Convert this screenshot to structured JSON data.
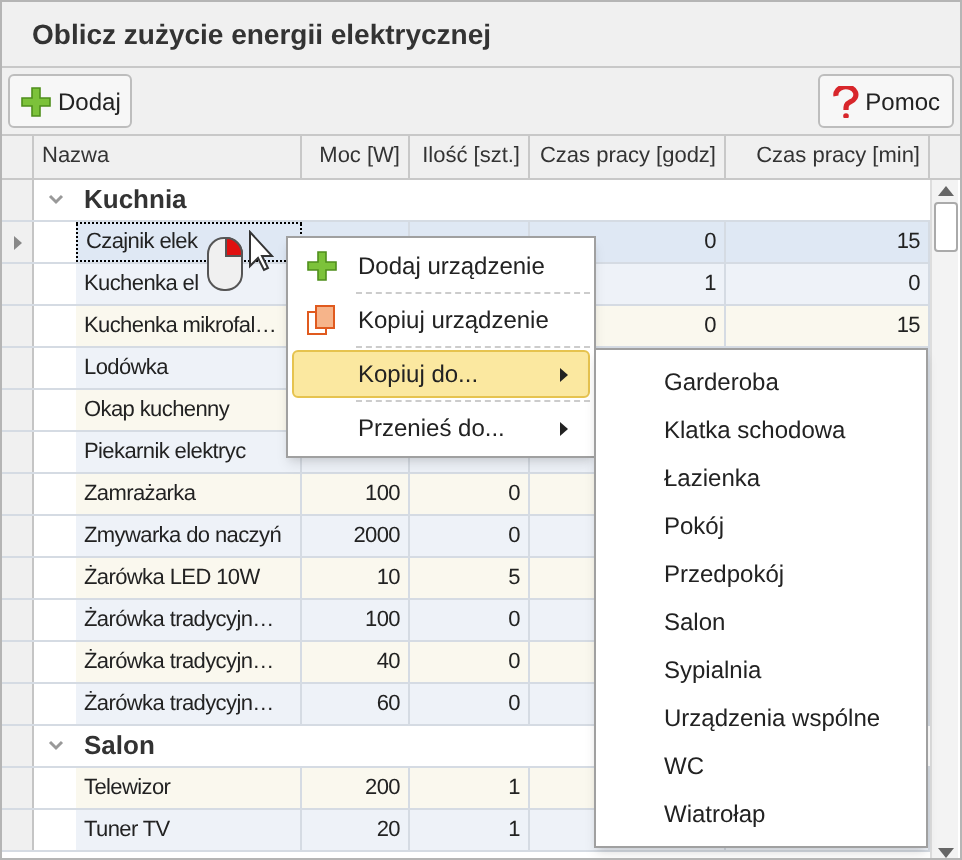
{
  "window": {
    "title": "Oblicz zużycie energii elektrycznej"
  },
  "toolbar": {
    "add_button": "Dodaj",
    "help_button": "Pomoc"
  },
  "table": {
    "columns": [
      "Nazwa",
      "Moc [W]",
      "Ilość [szt.]",
      "Czas pracy [godz]",
      "Czas pracy [min]"
    ],
    "groups": [
      {
        "name": "Kuchnia",
        "expanded": true,
        "rows": [
          {
            "cells": [
              "Czajnik elek",
              "",
              "",
              "0",
              "15"
            ],
            "selected": true
          },
          {
            "cells": [
              "Kuchenka el",
              "",
              "",
              "1",
              "0"
            ],
            "selected": false
          },
          {
            "cells": [
              "Kuchenka mikrofal…",
              "",
              "",
              "0",
              "15"
            ],
            "selected": false
          },
          {
            "cells": [
              "Lodówka",
              "",
              "",
              "",
              ""
            ],
            "selected": false
          },
          {
            "cells": [
              "Okap kuchenny",
              "",
              "",
              "",
              ""
            ],
            "selected": false
          },
          {
            "cells": [
              "Piekarnik elektryc",
              "",
              "",
              "",
              ""
            ],
            "selected": false
          },
          {
            "cells": [
              "Zamrażarka",
              "100",
              "0",
              "",
              ""
            ],
            "selected": false
          },
          {
            "cells": [
              "Zmywarka do naczyń",
              "2000",
              "0",
              "",
              ""
            ],
            "selected": false
          },
          {
            "cells": [
              "Żarówka LED 10W",
              "10",
              "5",
              "",
              ""
            ],
            "selected": false
          },
          {
            "cells": [
              "Żarówka tradycyjn…",
              "100",
              "0",
              "",
              ""
            ],
            "selected": false
          },
          {
            "cells": [
              "Żarówka tradycyjn…",
              "40",
              "0",
              "",
              ""
            ],
            "selected": false
          },
          {
            "cells": [
              "Żarówka tradycyjn…",
              "60",
              "0",
              "",
              ""
            ],
            "selected": false
          }
        ]
      },
      {
        "name": "Salon",
        "expanded": true,
        "rows": [
          {
            "cells": [
              "Telewizor",
              "200",
              "1",
              "",
              ""
            ],
            "selected": false
          },
          {
            "cells": [
              "Tuner TV",
              "20",
              "1",
              "",
              ""
            ],
            "selected": false
          }
        ]
      }
    ]
  },
  "context_menu": {
    "items": [
      {
        "label": "Dodaj urządzenie",
        "kind": "add",
        "selected": false,
        "has_submenu": false
      },
      {
        "label": "Kopiuj urządzenie",
        "kind": "copy",
        "selected": false,
        "has_submenu": false
      },
      {
        "label": "Kopiuj do...",
        "kind": "plain",
        "selected": true,
        "has_submenu": true
      },
      {
        "label": "Przenieś do...",
        "kind": "plain",
        "selected": false,
        "has_submenu": true
      }
    ]
  },
  "submenu": {
    "items": [
      "Garderoba",
      "Klatka schodowa",
      "Łazienka",
      "Pokój",
      "Przedpokój",
      "Salon",
      "Sypialnia",
      "Urządzenia wspólne",
      "WC",
      "Wiatrołap"
    ]
  }
}
